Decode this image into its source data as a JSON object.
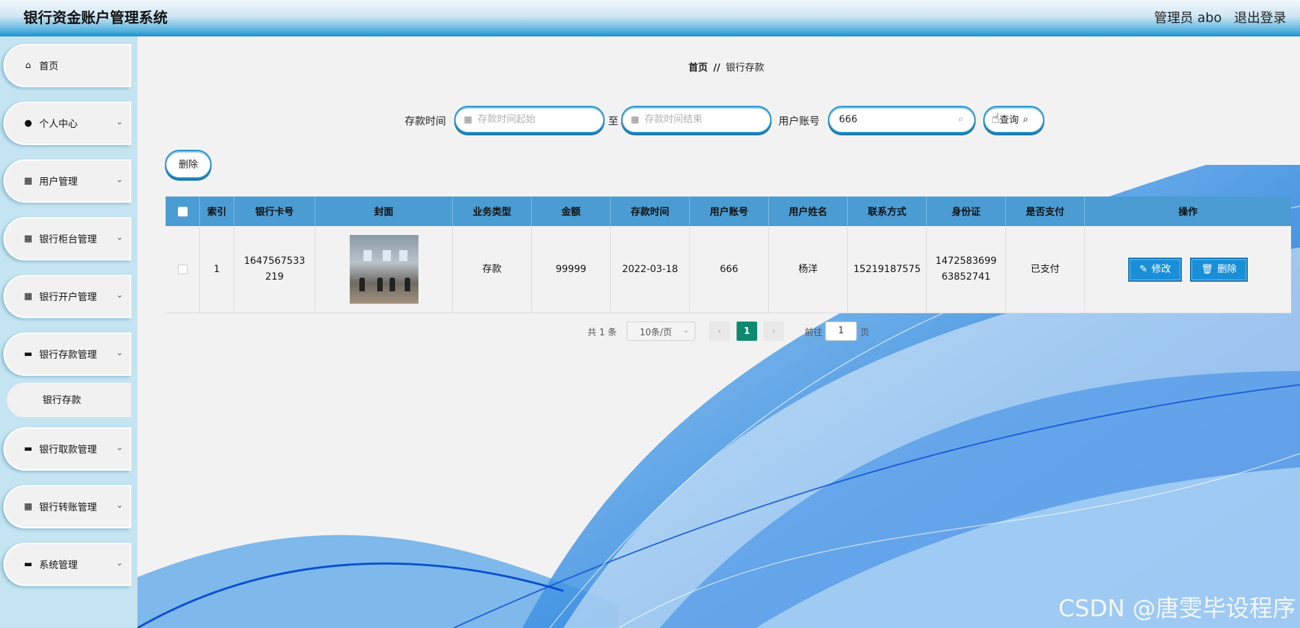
{
  "header": {
    "title": "银行资金账户管理系统",
    "admin": "管理员 abo",
    "logout": "退出登录"
  },
  "sidebar": {
    "items": [
      {
        "label": "首页",
        "icon": "home-icon",
        "glyph": "⌂",
        "chevron": ""
      },
      {
        "label": "个人中心",
        "icon": "user-icon",
        "glyph": "●",
        "chevron": "⌄"
      },
      {
        "label": "用户管理",
        "icon": "grid-icon",
        "glyph": "▦",
        "chevron": "⌄"
      },
      {
        "label": "银行柜台管理",
        "icon": "grid-icon",
        "glyph": "▦",
        "chevron": "⌄"
      },
      {
        "label": "银行开户管理",
        "icon": "grid-icon",
        "glyph": "▦",
        "chevron": "⌄"
      },
      {
        "label": "银行存款管理",
        "icon": "monitor-icon",
        "glyph": "▬",
        "chevron": "⌄"
      },
      {
        "label": "银行取款管理",
        "icon": "printer-icon",
        "glyph": "▬",
        "chevron": "⌄"
      },
      {
        "label": "银行转账管理",
        "icon": "apps-icon",
        "glyph": "▦",
        "chevron": "⌄"
      },
      {
        "label": "系统管理",
        "icon": "chat-icon",
        "glyph": "▬",
        "chevron": "⌄"
      }
    ],
    "sub_item": "银行存款"
  },
  "breadcrumb": {
    "home": "首页",
    "sep": "//",
    "current": "银行存款"
  },
  "search": {
    "time_label": "存款时间",
    "start_placeholder": "存款时间起始",
    "to_label": "至",
    "end_placeholder": "存款时间结束",
    "account_label": "用户账号",
    "account_value": "666",
    "query_label": "查询"
  },
  "toolbar": {
    "delete_label": "删除"
  },
  "table": {
    "headers": [
      "",
      "索引",
      "银行卡号",
      "封面",
      "业务类型",
      "金额",
      "存款时间",
      "用户账号",
      "用户姓名",
      "联系方式",
      "身份证",
      "是否支付",
      "操作"
    ],
    "rows": [
      {
        "index": "1",
        "card": "1647567533219",
        "type": "存款",
        "amount": "99999",
        "time": "2022-03-18",
        "account": "666",
        "name": "杨洋",
        "phone": "15219187575",
        "id_card": "147258369963852741",
        "paid": "已支付",
        "edit": "修改",
        "delete": "删除"
      }
    ]
  },
  "pagination": {
    "total": "共 1 条",
    "size": "10条/页",
    "current": "1",
    "goto": "前往",
    "goto_value": "1",
    "page_suffix": "页"
  },
  "watermark": "CSDN @唐雯毕设程序",
  "colors": {
    "accent": "#2a94cc",
    "table_header": "#4a9cd3",
    "button": "#1a8fd8",
    "page_active": "#0e8a70"
  }
}
